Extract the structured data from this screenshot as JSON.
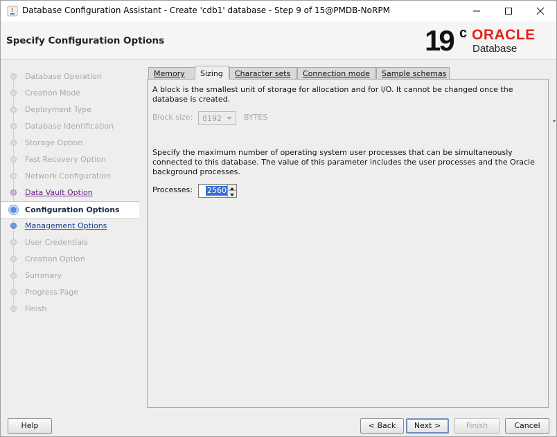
{
  "window": {
    "title": "Database Configuration Assistant - Create 'cdb1' database - Step 9 of 15@PMDB-NoRPM",
    "controls": {
      "minimize": "—",
      "maximize": "☐",
      "close": "✕"
    }
  },
  "header": {
    "title": "Specify Configuration Options",
    "brand": {
      "version": "19",
      "version_suffix": "c",
      "vendor": "ORACLE",
      "product": "Database"
    }
  },
  "steps": [
    {
      "label": "Database Operation",
      "state": "disabled"
    },
    {
      "label": "Creation Mode",
      "state": "disabled"
    },
    {
      "label": "Deployment Type",
      "state": "disabled"
    },
    {
      "label": "Database Identification",
      "state": "disabled"
    },
    {
      "label": "Storage Option",
      "state": "disabled"
    },
    {
      "label": "Fast Recovery Option",
      "state": "disabled"
    },
    {
      "label": "Network Configuration",
      "state": "disabled"
    },
    {
      "label": "Data Vault Option",
      "state": "done"
    },
    {
      "label": "Configuration Options",
      "state": "current"
    },
    {
      "label": "Management Options",
      "state": "link"
    },
    {
      "label": "User Credentials",
      "state": "disabled"
    },
    {
      "label": "Creation Option",
      "state": "disabled"
    },
    {
      "label": "Summary",
      "state": "disabled"
    },
    {
      "label": "Progress Page",
      "state": "disabled"
    },
    {
      "label": "Finish",
      "state": "disabled"
    }
  ],
  "tabs": [
    {
      "label": "Memory",
      "active": false
    },
    {
      "label": "Sizing",
      "active": true
    },
    {
      "label": "Character sets",
      "active": false
    },
    {
      "label": "Connection mode",
      "active": false
    },
    {
      "label": "Sample schemas",
      "active": false
    }
  ],
  "sizing": {
    "block_description": "A block is the smallest unit of storage for allocation and for I/O. It cannot be changed once the database is created.",
    "block_size_label": "Block size:",
    "block_size_value": "8192",
    "block_size_unit": "BYTES",
    "processes_description": "Specify the maximum number of operating system user processes that can be simultaneously connected to this database. The value of this parameter includes the user processes and the Oracle background processes.",
    "processes_label": "Processes:",
    "processes_value": "2560"
  },
  "buttons": {
    "help": "Help",
    "back": "< Back",
    "next": "Next >",
    "finish": "Finish",
    "cancel": "Cancel"
  },
  "colors": {
    "oracle_red": "#e2231a",
    "done_step": "#6b1e83",
    "link_step": "#183e8c",
    "selection": "#3b6fd1"
  }
}
